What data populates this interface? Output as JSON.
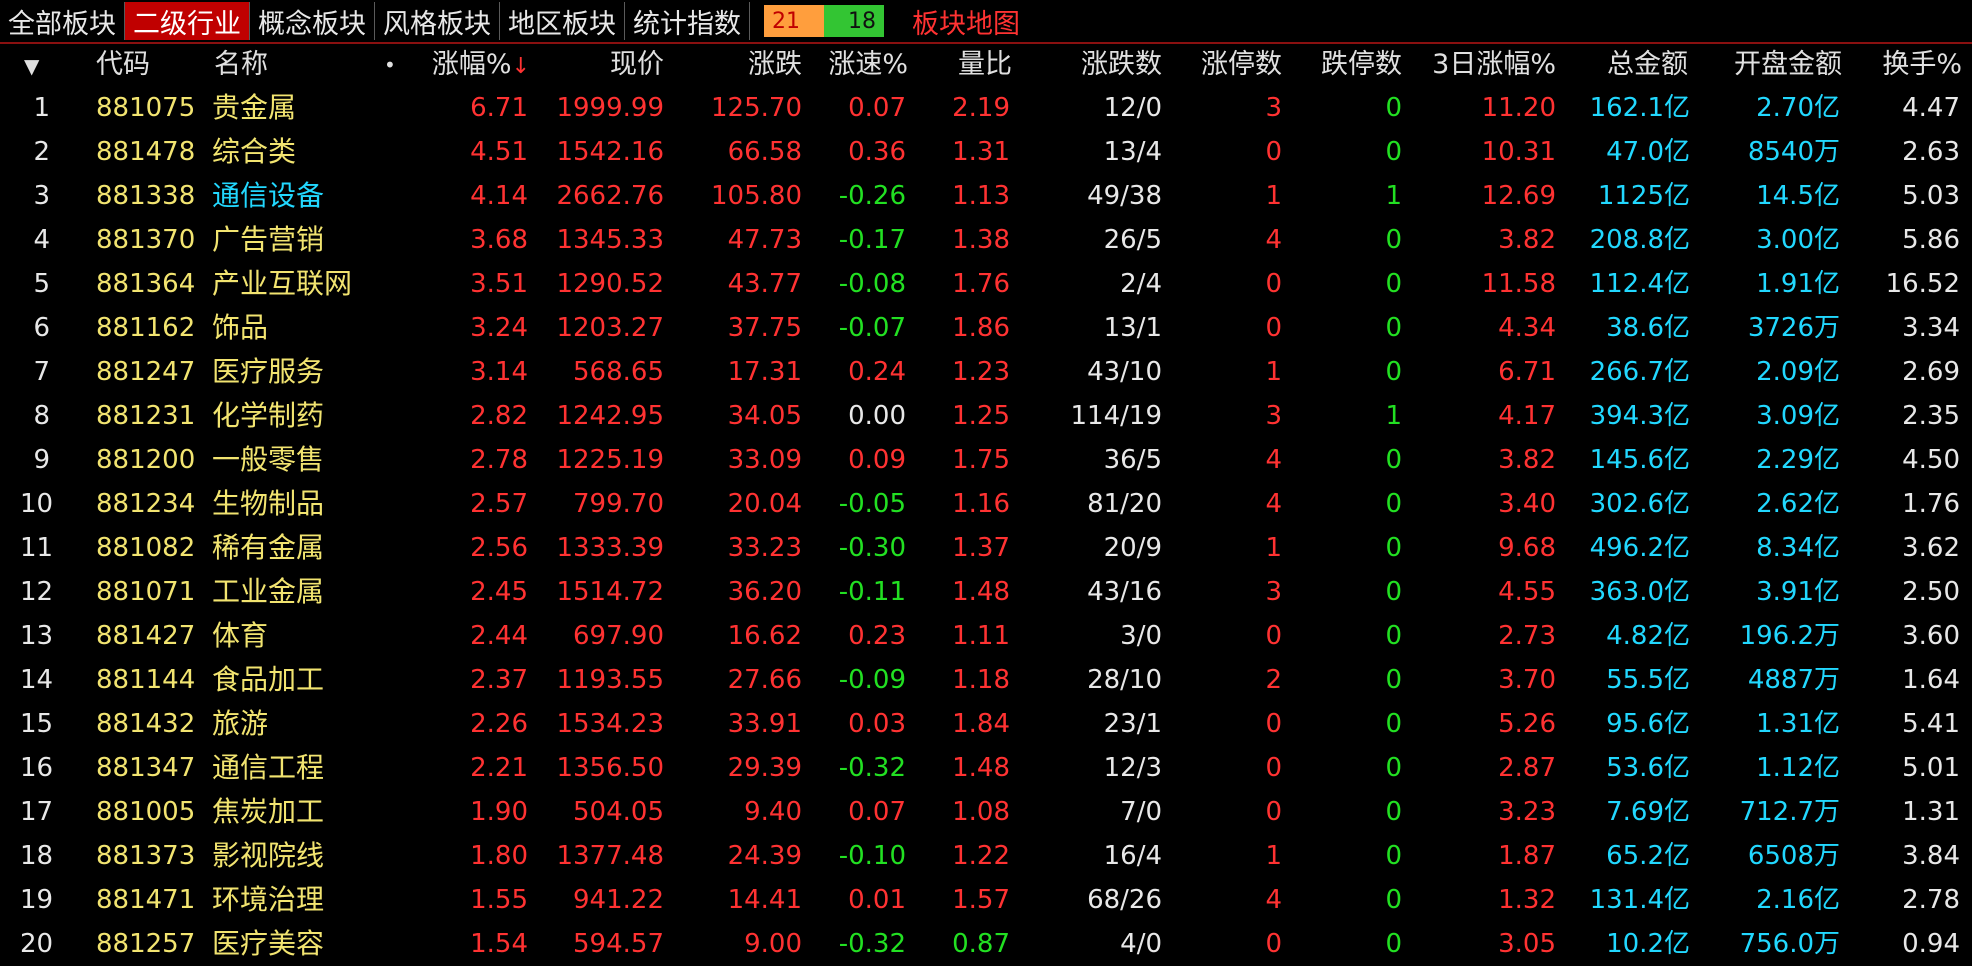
{
  "tabs": [
    {
      "label": "全部板块",
      "active": false
    },
    {
      "label": "二级行业",
      "active": true
    },
    {
      "label": "概念板块",
      "active": false
    },
    {
      "label": "风格板块",
      "active": false
    },
    {
      "label": "地区板块",
      "active": false
    },
    {
      "label": "统计指数",
      "active": false
    }
  ],
  "updown": {
    "up": "21",
    "down": "18"
  },
  "map_link": "板块地图",
  "header": {
    "code": "代码",
    "name": "名称",
    "dot": "•",
    "pct": "涨幅%",
    "price": "现价",
    "change": "涨跌",
    "speed": "涨速%",
    "vol_ratio": "量比",
    "updown_count": "涨跌数",
    "limit_up": "涨停数",
    "limit_down": "跌停数",
    "three_day": "3日涨幅%",
    "total_amount": "总金额",
    "open_amount": "开盘金额",
    "turnover": "换手%"
  },
  "rows": [
    {
      "seq": "1",
      "code": "881075",
      "name": "贵金属",
      "pct": "6.71",
      "price": "1999.99",
      "change": "125.70",
      "speed": "0.07",
      "vol": "2.19",
      "ud": "12/0",
      "lu": "3",
      "ld": "0",
      "d3": "11.20",
      "total": "162.1亿",
      "open": "2.70亿",
      "turn": "4.47"
    },
    {
      "seq": "2",
      "code": "881478",
      "name": "综合类",
      "pct": "4.51",
      "price": "1542.16",
      "change": "66.58",
      "speed": "0.36",
      "vol": "1.31",
      "ud": "13/4",
      "lu": "0",
      "ld": "0",
      "d3": "10.31",
      "total": "47.0亿",
      "open": "8540万",
      "turn": "2.63"
    },
    {
      "seq": "3",
      "code": "881338",
      "name": "通信设备",
      "pct": "4.14",
      "price": "2662.76",
      "change": "105.80",
      "speed": "-0.26",
      "vol": "1.13",
      "ud": "49/38",
      "lu": "1",
      "ld": "1",
      "d3": "12.69",
      "total": "1125亿",
      "open": "14.5亿",
      "turn": "5.03"
    },
    {
      "seq": "4",
      "code": "881370",
      "name": "广告营销",
      "pct": "3.68",
      "price": "1345.33",
      "change": "47.73",
      "speed": "-0.17",
      "vol": "1.38",
      "ud": "26/5",
      "lu": "4",
      "ld": "0",
      "d3": "3.82",
      "total": "208.8亿",
      "open": "3.00亿",
      "turn": "5.86"
    },
    {
      "seq": "5",
      "code": "881364",
      "name": "产业互联网",
      "pct": "3.51",
      "price": "1290.52",
      "change": "43.77",
      "speed": "-0.08",
      "vol": "1.76",
      "ud": "2/4",
      "lu": "0",
      "ld": "0",
      "d3": "11.58",
      "total": "112.4亿",
      "open": "1.91亿",
      "turn": "16.52"
    },
    {
      "seq": "6",
      "code": "881162",
      "name": "饰品",
      "pct": "3.24",
      "price": "1203.27",
      "change": "37.75",
      "speed": "-0.07",
      "vol": "1.86",
      "ud": "13/1",
      "lu": "0",
      "ld": "0",
      "d3": "4.34",
      "total": "38.6亿",
      "open": "3726万",
      "turn": "3.34"
    },
    {
      "seq": "7",
      "code": "881247",
      "name": "医疗服务",
      "pct": "3.14",
      "price": "568.65",
      "change": "17.31",
      "speed": "0.24",
      "vol": "1.23",
      "ud": "43/10",
      "lu": "1",
      "ld": "0",
      "d3": "6.71",
      "total": "266.7亿",
      "open": "2.09亿",
      "turn": "2.69"
    },
    {
      "seq": "8",
      "code": "881231",
      "name": "化学制药",
      "pct": "2.82",
      "price": "1242.95",
      "change": "34.05",
      "speed": "0.00",
      "vol": "1.25",
      "ud": "114/19",
      "lu": "3",
      "ld": "1",
      "d3": "4.17",
      "total": "394.3亿",
      "open": "3.09亿",
      "turn": "2.35"
    },
    {
      "seq": "9",
      "code": "881200",
      "name": "一般零售",
      "pct": "2.78",
      "price": "1225.19",
      "change": "33.09",
      "speed": "0.09",
      "vol": "1.75",
      "ud": "36/5",
      "lu": "4",
      "ld": "0",
      "d3": "3.82",
      "total": "145.6亿",
      "open": "2.29亿",
      "turn": "4.50"
    },
    {
      "seq": "10",
      "code": "881234",
      "name": "生物制品",
      "pct": "2.57",
      "price": "799.70",
      "change": "20.04",
      "speed": "-0.05",
      "vol": "1.16",
      "ud": "81/20",
      "lu": "4",
      "ld": "0",
      "d3": "3.40",
      "total": "302.6亿",
      "open": "2.62亿",
      "turn": "1.76"
    },
    {
      "seq": "11",
      "code": "881082",
      "name": "稀有金属",
      "pct": "2.56",
      "price": "1333.39",
      "change": "33.23",
      "speed": "-0.30",
      "vol": "1.37",
      "ud": "20/9",
      "lu": "1",
      "ld": "0",
      "d3": "9.68",
      "total": "496.2亿",
      "open": "8.34亿",
      "turn": "3.62"
    },
    {
      "seq": "12",
      "code": "881071",
      "name": "工业金属",
      "pct": "2.45",
      "price": "1514.72",
      "change": "36.20",
      "speed": "-0.11",
      "vol": "1.48",
      "ud": "43/16",
      "lu": "3",
      "ld": "0",
      "d3": "4.55",
      "total": "363.0亿",
      "open": "3.91亿",
      "turn": "2.50"
    },
    {
      "seq": "13",
      "code": "881427",
      "name": "体育",
      "pct": "2.44",
      "price": "697.90",
      "change": "16.62",
      "speed": "0.23",
      "vol": "1.11",
      "ud": "3/0",
      "lu": "0",
      "ld": "0",
      "d3": "2.73",
      "total": "4.82亿",
      "open": "196.2万",
      "turn": "3.60"
    },
    {
      "seq": "14",
      "code": "881144",
      "name": "食品加工",
      "pct": "2.37",
      "price": "1193.55",
      "change": "27.66",
      "speed": "-0.09",
      "vol": "1.18",
      "ud": "28/10",
      "lu": "2",
      "ld": "0",
      "d3": "3.70",
      "total": "55.5亿",
      "open": "4887万",
      "turn": "1.64"
    },
    {
      "seq": "15",
      "code": "881432",
      "name": "旅游",
      "pct": "2.26",
      "price": "1534.23",
      "change": "33.91",
      "speed": "0.03",
      "vol": "1.84",
      "ud": "23/1",
      "lu": "0",
      "ld": "0",
      "d3": "5.26",
      "total": "95.6亿",
      "open": "1.31亿",
      "turn": "5.41"
    },
    {
      "seq": "16",
      "code": "881347",
      "name": "通信工程",
      "pct": "2.21",
      "price": "1356.50",
      "change": "29.39",
      "speed": "-0.32",
      "vol": "1.48",
      "ud": "12/3",
      "lu": "0",
      "ld": "0",
      "d3": "2.87",
      "total": "53.6亿",
      "open": "1.12亿",
      "turn": "5.01"
    },
    {
      "seq": "17",
      "code": "881005",
      "name": "焦炭加工",
      "pct": "1.90",
      "price": "504.05",
      "change": "9.40",
      "speed": "0.07",
      "vol": "1.08",
      "ud": "7/0",
      "lu": "0",
      "ld": "0",
      "d3": "3.23",
      "total": "7.69亿",
      "open": "712.7万",
      "turn": "1.31"
    },
    {
      "seq": "18",
      "code": "881373",
      "name": "影视院线",
      "pct": "1.80",
      "price": "1377.48",
      "change": "24.39",
      "speed": "-0.10",
      "vol": "1.22",
      "ud": "16/4",
      "lu": "1",
      "ld": "0",
      "d3": "1.87",
      "total": "65.2亿",
      "open": "6508万",
      "turn": "3.84"
    },
    {
      "seq": "19",
      "code": "881471",
      "name": "环境治理",
      "pct": "1.55",
      "price": "941.22",
      "change": "14.41",
      "speed": "0.01",
      "vol": "1.57",
      "ud": "68/26",
      "lu": "4",
      "ld": "0",
      "d3": "1.32",
      "total": "131.4亿",
      "open": "2.16亿",
      "turn": "2.78"
    },
    {
      "seq": "20",
      "code": "881257",
      "name": "医疗美容",
      "pct": "1.54",
      "price": "594.57",
      "change": "9.00",
      "speed": "-0.32",
      "vol": "0.87",
      "ud": "4/0",
      "lu": "0",
      "ld": "0",
      "d3": "3.05",
      "total": "10.2亿",
      "open": "756.0万",
      "turn": "0.94"
    }
  ],
  "highlight_row": 3,
  "colors": {
    "up": "#ff3232",
    "down": "#22e022",
    "flat": "#e8e8e8",
    "code": "#f2e470",
    "amount": "#22d8ff",
    "active_tab": "#c00000"
  }
}
